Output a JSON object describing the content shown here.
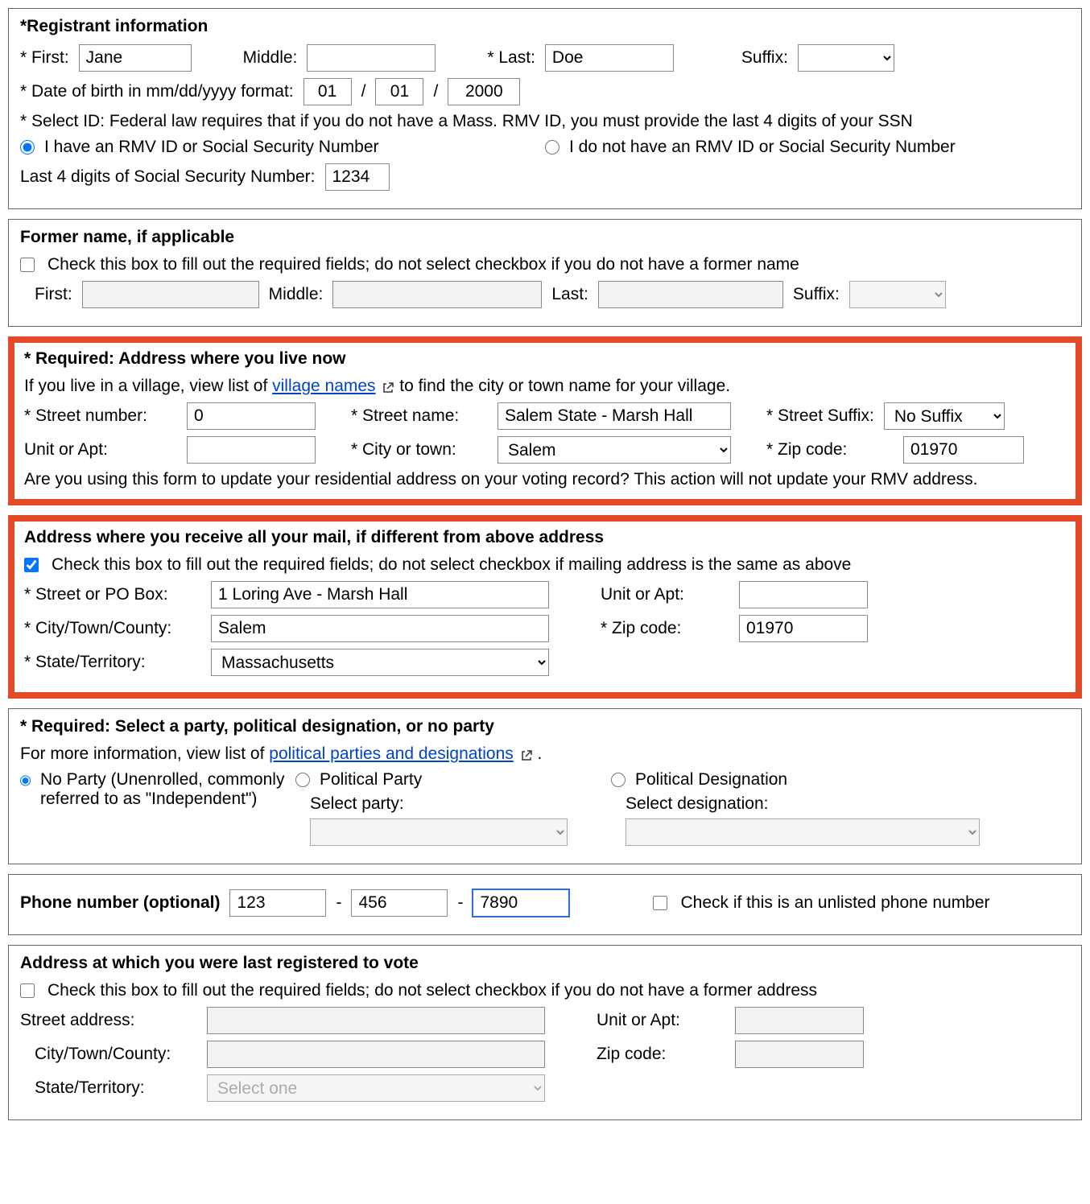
{
  "registrant": {
    "heading": "*Registrant information",
    "first_label": "* First:",
    "first_value": "Jane",
    "middle_label": "Middle:",
    "middle_value": "",
    "last_label": "* Last:",
    "last_value": "Doe",
    "suffix_label": "Suffix:",
    "suffix_value": "",
    "dob_label": "* Date of birth in mm/dd/yyyy format:",
    "dob_mm": "01",
    "dob_dd": "01",
    "dob_yyyy": "2000",
    "slash": "/",
    "id_intro": "* Select ID: Federal law requires that if you do not have a Mass. RMV ID, you must provide the last 4 digits of your SSN",
    "id_have_label": "I have an RMV ID or Social Security Number",
    "id_no_label": "I do not have an RMV ID or Social Security Number",
    "ssn_label": "Last 4 digits of Social Security Number:",
    "ssn_value": "1234"
  },
  "former_name": {
    "heading": "Former name, if applicable",
    "check_label": "Check this box to fill out the required fields; do not select checkbox if you do not have a former name",
    "first_label": "First:",
    "middle_label": "Middle:",
    "last_label": "Last:",
    "suffix_label": "Suffix:"
  },
  "live_address": {
    "heading": "* Required: Address where you live now",
    "intro_pre": "If you live in a village, view list of ",
    "village_link": "village names",
    "intro_post": " to find the city or town name for your village.",
    "street_num_label": "* Street number:",
    "street_num_value": "0",
    "street_name_label": "* Street name:",
    "street_name_value": "Salem State - Marsh Hall",
    "street_suffix_label": "* Street Suffix:",
    "street_suffix_value": "No Suffix",
    "unit_label": "Unit or Apt:",
    "unit_value": "",
    "city_label": "* City or town:",
    "city_value": "Salem",
    "zip_label": "* Zip code:",
    "zip_value": "01970",
    "update_q": "Are you using this form to update your residential address on your voting record? This action will not update your RMV address."
  },
  "mail_address": {
    "heading": "Address where you receive all your mail, if different from above address",
    "check_label": "Check this box to fill out the required fields; do not select checkbox if mailing address is the same as above",
    "street_label": "* Street or PO Box:",
    "street_value": "1 Loring Ave - Marsh Hall",
    "unit_label": "Unit or Apt:",
    "unit_value": "",
    "city_label": "* City/Town/County:",
    "city_value": "Salem",
    "zip_label": "* Zip code:",
    "zip_value": "01970",
    "state_label": "* State/Territory:",
    "state_value": "Massachusetts"
  },
  "party": {
    "heading": "* Required: Select a party, political designation, or no party",
    "intro_pre": "For more information, view list of ",
    "link": "political parties and designations",
    "intro_post": ".",
    "no_party_label": "No Party (Unenrolled, commonly referred to as \"Independent\")",
    "party_label": "Political Party",
    "select_party_label": "Select party:",
    "designation_label": "Political Designation",
    "select_designation_label": "Select designation:"
  },
  "phone": {
    "label": "Phone number (optional)",
    "p1": "123",
    "dash": "-",
    "p2": "456",
    "p3": "7890",
    "unlisted_label": "Check if this is an unlisted phone number"
  },
  "last_reg": {
    "heading": "Address at which you were last registered to vote",
    "check_label": "Check this box to fill out the required fields; do not select checkbox if you do not have a former address",
    "street_label": "Street address:",
    "unit_label": "Unit or Apt:",
    "city_label": "City/Town/County:",
    "zip_label": "Zip code:",
    "state_label": "State/Territory:",
    "state_value": "Select one"
  }
}
